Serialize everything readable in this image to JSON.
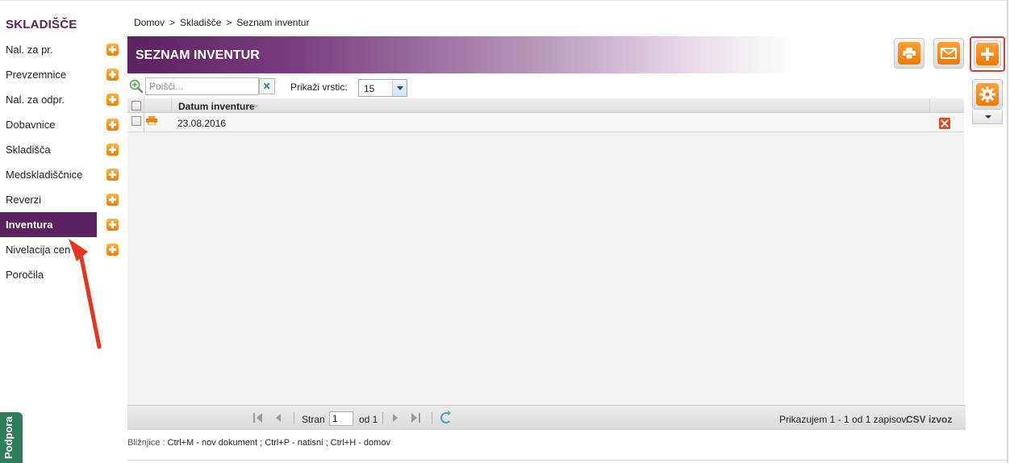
{
  "sidebar": {
    "title": "SKLADIŠČE",
    "items": [
      {
        "label": "Nal. za pr.",
        "has_add": true
      },
      {
        "label": "Prevzemnice",
        "has_add": true
      },
      {
        "label": "Nal. za odpr.",
        "has_add": true
      },
      {
        "label": "Dobavnice",
        "has_add": true
      },
      {
        "label": "Skladišča",
        "has_add": true
      },
      {
        "label": "Medskladiščnice",
        "has_add": true
      },
      {
        "label": "Reverzi",
        "has_add": true
      },
      {
        "label": "Inventura",
        "has_add": true,
        "active": true
      },
      {
        "label": "Nivelacija cen",
        "has_add": true
      },
      {
        "label": "Poročila",
        "has_add": false
      }
    ],
    "support_tab": "Podpora"
  },
  "breadcrumb": {
    "items": [
      "Domov",
      "Skladišče",
      "Seznam inventur"
    ],
    "separator": ">"
  },
  "header": {
    "title": "SEZNAM INVENTUR"
  },
  "toolbar": {
    "print_icon": "printer-icon",
    "email_icon": "envelope-icon",
    "add_icon": "plus-icon",
    "settings_icon": "gear-icon"
  },
  "search": {
    "placeholder": "Poišči...",
    "value": ""
  },
  "rows_per_page": {
    "label": "Prikaži vrstic:",
    "value": "15"
  },
  "grid": {
    "columns": [
      "Datum inventure"
    ],
    "rows": [
      {
        "date": "23.08.2016"
      }
    ]
  },
  "pager": {
    "page_label": "Stran",
    "page_value": "1",
    "of_label": "od 1",
    "status": "Prikazujem 1 - 1 od 1 zapisov.",
    "csv_label": "CSV izvoz"
  },
  "shortcuts": {
    "label": "Bližnjice :",
    "items": "Ctrl+M - nov dokument ;  Ctrl+P - natisni ;  Ctrl+H - domov"
  },
  "colors": {
    "brand_purple": "#5b2160",
    "accent_orange": "#f07e00",
    "annotation_red": "#e8341c"
  }
}
